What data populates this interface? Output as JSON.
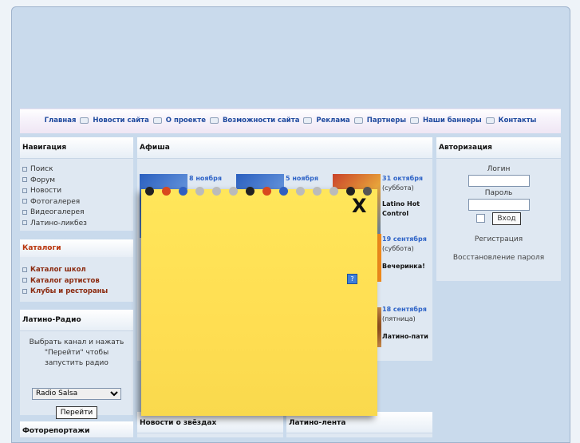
{
  "topnav": {
    "items": [
      "Главная",
      "Новости сайта",
      "О проекте",
      "Возможности сайта",
      "Реклама",
      "Партнеры",
      "Наши баннеры",
      "Контакты"
    ]
  },
  "navigation": {
    "title": "Навигация",
    "items": [
      "Поиск",
      "Форум",
      "Новости",
      "Фотогалерея",
      "Видеогалерея",
      "Латино-ликбез"
    ]
  },
  "catalogs": {
    "title": "Каталоги",
    "items": [
      "Каталог школ",
      "Каталог артистов",
      "Клубы и рестораны"
    ]
  },
  "radio": {
    "title": "Латино-Радио",
    "text": "Выбрать канал и нажать \"Перейти\" чтобы запустить радио",
    "selected": "Radio Salsa",
    "button": "Перейти"
  },
  "photoreports": {
    "title": "Фоторепортажи"
  },
  "afisha": {
    "title": "Афиша",
    "events": [
      {
        "date": "8 ноября"
      },
      {
        "date": "5 ноября"
      },
      {
        "date": "31 октября",
        "day": "(суббота)",
        "name": "Latino Hot Control"
      },
      {
        "date": "19 сентября",
        "day": "(суббота)",
        "name": "Вечеринка!"
      },
      {
        "date": "18 сентября",
        "day": "(пятница)",
        "name": "Латино-пати"
      }
    ]
  },
  "starnews": {
    "title": "Новости о звёздах"
  },
  "latinolenta": {
    "title": "Латино-лента"
  },
  "auth": {
    "title": "Авторизация",
    "login_label": "Логин",
    "password_label": "Пароль",
    "login_button": "Вход",
    "register": "Регистрация",
    "restore": "Восстановление пароля"
  },
  "note": {
    "close_label": "X",
    "help_label": "?"
  }
}
